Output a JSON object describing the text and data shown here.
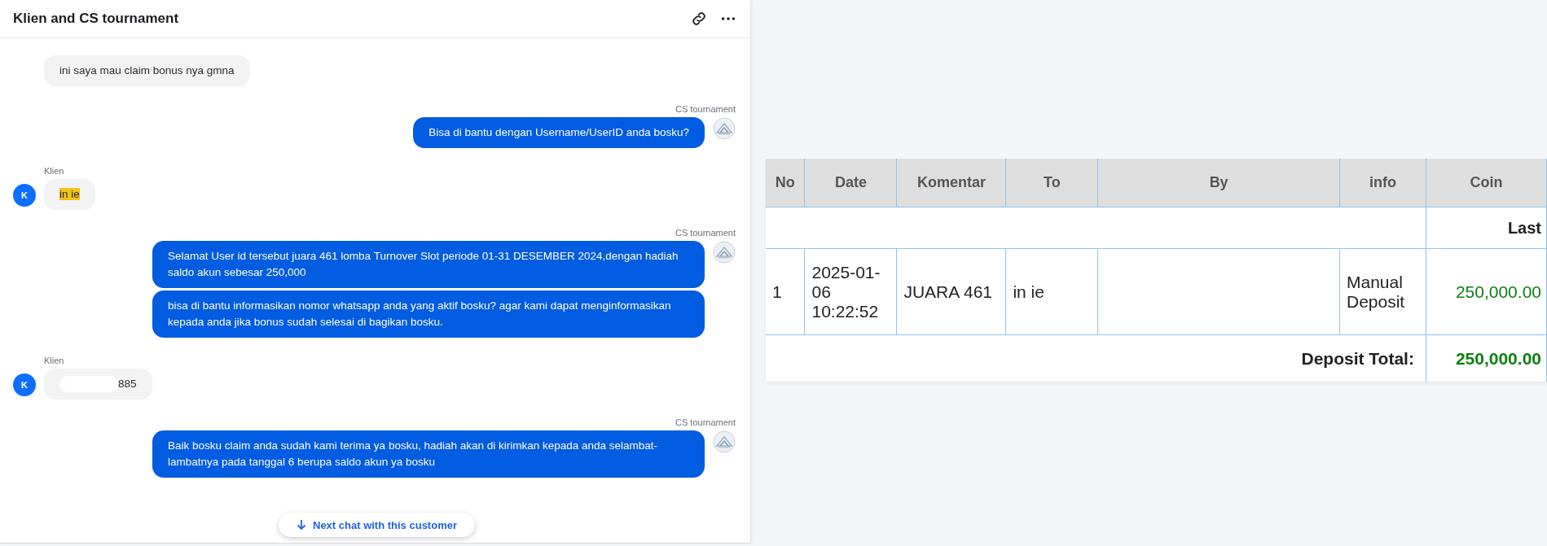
{
  "chat": {
    "title": "Klien and CS tournament",
    "groups": [
      {
        "kind": "client",
        "messages": [
          {
            "text": "ini saya mau claim bonus nya gmna",
            "highlighted": false,
            "redacted": false
          }
        ]
      },
      {
        "kind": "agent",
        "sender": "CS tournament",
        "messages": [
          {
            "text": "Bisa di bantu dengan Username/UserID anda bosku?",
            "highlighted": false,
            "redacted": false
          }
        ]
      },
      {
        "kind": "client",
        "sender": "Klien",
        "avatar": "K",
        "messages": [
          {
            "text": "in ie",
            "highlighted": true,
            "redacted": false
          }
        ]
      },
      {
        "kind": "agent",
        "sender": "CS tournament",
        "messages": [
          {
            "text": "Selamat User id tersebut juara 461 lomba Turnover Slot periode 01-31 DESEMBER 2024,dengan hadiah saldo akun sebesar 250,000",
            "highlighted": false,
            "redacted": false
          },
          {
            "text": "bisa di bantu informasikan nomor whatsapp anda yang aktif bosku? agar kami dapat menginformasikan kepada anda jika bonus sudah selesai di bagikan bosku.",
            "highlighted": false,
            "redacted": false
          }
        ]
      },
      {
        "kind": "client",
        "sender": "Klien",
        "avatar": "K",
        "messages": [
          {
            "text": "885",
            "highlighted": false,
            "redacted": true
          }
        ]
      },
      {
        "kind": "agent",
        "sender": "CS tournament",
        "messages": [
          {
            "text": "Baik bosku claim anda sudah kami terima ya bosku, hadiah akan di kirimkan kepada anda selambat-lambatnya pada tanggal 6 berupa saldo akun ya bosku",
            "highlighted": false,
            "redacted": false
          }
        ]
      }
    ],
    "next_button": "Next chat with this customer"
  },
  "table": {
    "columns": [
      "No",
      "Date",
      "Komentar",
      "To",
      "By",
      "info",
      "Coin"
    ],
    "section_label": "Last",
    "rows": [
      {
        "no": "1",
        "date": "2025-01-06 10:22:52",
        "comment": "JUARA 461",
        "to": "in ie",
        "info": "Manual Deposit",
        "coin": "250,000.00"
      }
    ],
    "total_label": "Deposit Total:",
    "total": "250,000.00"
  }
}
